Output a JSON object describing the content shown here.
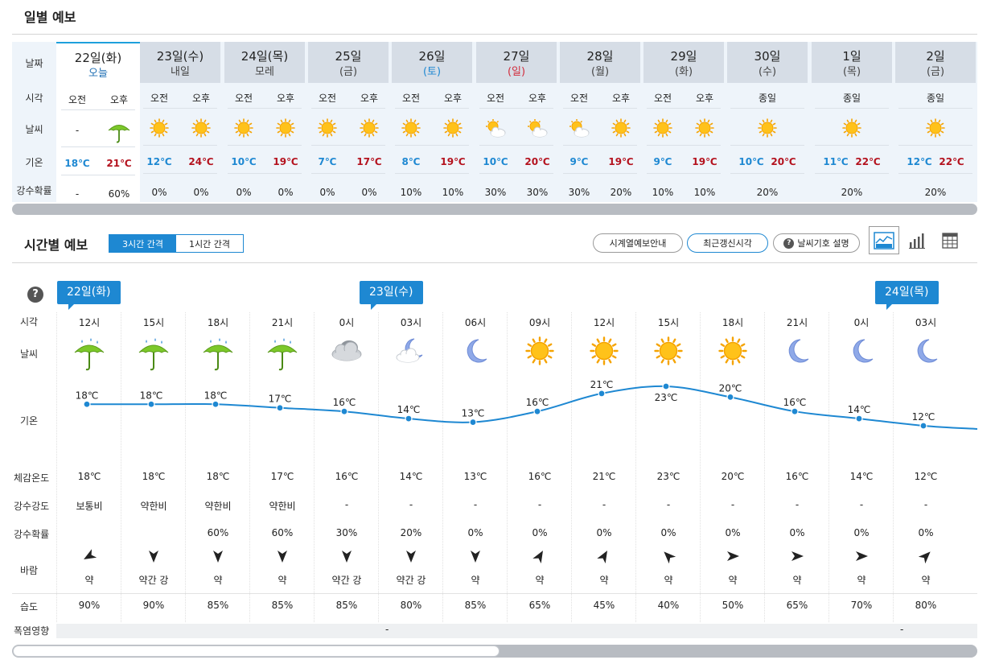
{
  "daily": {
    "title": "일별 예보",
    "row_labels": [
      "날짜",
      "시각",
      "날씨",
      "기온",
      "강수확률"
    ],
    "days": [
      {
        "date": "22일(화)",
        "sub": "오늘",
        "kind": "today",
        "split": true,
        "periods": [
          "오전",
          "오후"
        ],
        "weather": [
          "none",
          "umbrella"
        ],
        "am_text": "-",
        "low": "18℃",
        "high": "21℃",
        "pop": [
          "-",
          "60%"
        ]
      },
      {
        "date": "23일(수)",
        "sub": "내일",
        "kind": "",
        "split": true,
        "periods": [
          "오전",
          "오후"
        ],
        "weather": [
          "sun",
          "sun"
        ],
        "low": "12℃",
        "high": "24℃",
        "pop": [
          "0%",
          "0%"
        ]
      },
      {
        "date": "24일(목)",
        "sub": "모레",
        "kind": "",
        "split": true,
        "periods": [
          "오전",
          "오후"
        ],
        "weather": [
          "sun",
          "sun"
        ],
        "low": "10℃",
        "high": "19℃",
        "pop": [
          "0%",
          "0%"
        ]
      },
      {
        "date": "25일",
        "sub": "(금)",
        "kind": "",
        "split": true,
        "periods": [
          "오전",
          "오후"
        ],
        "weather": [
          "sun",
          "sun"
        ],
        "low": "7℃",
        "high": "17℃",
        "pop": [
          "0%",
          "0%"
        ]
      },
      {
        "date": "26일",
        "sub": "(토)",
        "kind": "sat",
        "split": true,
        "periods": [
          "오전",
          "오후"
        ],
        "weather": [
          "sun",
          "sun"
        ],
        "low": "8℃",
        "high": "19℃",
        "pop": [
          "10%",
          "10%"
        ]
      },
      {
        "date": "27일",
        "sub": "(일)",
        "kind": "sun",
        "split": true,
        "periods": [
          "오전",
          "오후"
        ],
        "weather": [
          "suncloud",
          "suncloud"
        ],
        "low": "10℃",
        "high": "20℃",
        "pop": [
          "30%",
          "30%"
        ]
      },
      {
        "date": "28일",
        "sub": "(월)",
        "kind": "",
        "split": true,
        "periods": [
          "오전",
          "오후"
        ],
        "weather": [
          "suncloud",
          "sun"
        ],
        "low": "9℃",
        "high": "19℃",
        "pop": [
          "30%",
          "20%"
        ]
      },
      {
        "date": "29일",
        "sub": "(화)",
        "kind": "",
        "split": true,
        "periods": [
          "오전",
          "오후"
        ],
        "weather": [
          "sun",
          "sun"
        ],
        "low": "9℃",
        "high": "19℃",
        "pop": [
          "10%",
          "10%"
        ]
      },
      {
        "date": "30일",
        "sub": "(수)",
        "kind": "",
        "split": false,
        "periods": [
          "종일"
        ],
        "weather": [
          "sun"
        ],
        "low": "10℃",
        "high": "20℃",
        "pop": [
          "20%"
        ]
      },
      {
        "date": "1일",
        "sub": "(목)",
        "kind": "",
        "split": false,
        "periods": [
          "종일"
        ],
        "weather": [
          "sun"
        ],
        "low": "11℃",
        "high": "22℃",
        "pop": [
          "20%"
        ]
      },
      {
        "date": "2일",
        "sub": "(금)",
        "kind": "",
        "split": false,
        "periods": [
          "종일"
        ],
        "weather": [
          "sun"
        ],
        "low": "12℃",
        "high": "22℃",
        "pop": [
          "20%"
        ]
      }
    ]
  },
  "hourly": {
    "title": "시간별 예보",
    "interval_3h": "3시간 간격",
    "interval_1h": "1시간 간격",
    "btn_series_guide": "시계열예보안내",
    "btn_latest": "최근갱신시각",
    "btn_symbols": "날씨기호 설명",
    "help": "?",
    "badges": [
      "22일(화)",
      "23일(수)",
      "24일(목)"
    ],
    "row_labels": {
      "time": "시각",
      "weather": "날씨",
      "temp": "기온",
      "feels": "체감온도",
      "precip_intensity": "강수강도",
      "pop": "강수확률",
      "wind": "바람",
      "humidity": "습도",
      "heat": "폭염영향"
    },
    "heat_values": [
      "-",
      "-"
    ],
    "hours": [
      {
        "time": "12시",
        "icon": "umbrella",
        "temp": 18,
        "temp_label": "18℃",
        "feels": "18℃",
        "intensity": "보통비",
        "pop": "",
        "wind_dir": 60,
        "wind": "약",
        "humidity": "90%"
      },
      {
        "time": "15시",
        "icon": "umbrella",
        "temp": 18,
        "temp_label": "18℃",
        "feels": "18℃",
        "intensity": "약한비",
        "pop": "",
        "wind_dir": 0,
        "wind": "약간 강",
        "humidity": "90%"
      },
      {
        "time": "18시",
        "icon": "umbrella",
        "temp": 18,
        "temp_label": "18℃",
        "feels": "18℃",
        "intensity": "약한비",
        "pop": "60%",
        "wind_dir": 0,
        "wind": "약",
        "humidity": "85%"
      },
      {
        "time": "21시",
        "icon": "umbrella",
        "temp": 17,
        "temp_label": "17℃",
        "feels": "17℃",
        "intensity": "약한비",
        "pop": "60%",
        "wind_dir": 0,
        "wind": "약",
        "humidity": "85%"
      },
      {
        "time": "0시",
        "icon": "cloud",
        "temp": 16,
        "temp_label": "16℃",
        "feels": "16℃",
        "intensity": "-",
        "pop": "30%",
        "wind_dir": 0,
        "wind": "약간 강",
        "humidity": "85%"
      },
      {
        "time": "03시",
        "icon": "mooncloud",
        "temp": 14,
        "temp_label": "14℃",
        "feels": "14℃",
        "intensity": "-",
        "pop": "20%",
        "wind_dir": 0,
        "wind": "약간 강",
        "humidity": "80%"
      },
      {
        "time": "06시",
        "icon": "moon",
        "temp": 13,
        "temp_label": "13℃",
        "feels": "13℃",
        "intensity": "-",
        "pop": "0%",
        "wind_dir": 0,
        "wind": "약",
        "humidity": "85%"
      },
      {
        "time": "09시",
        "icon": "sun",
        "temp": 16,
        "temp_label": "16℃",
        "feels": "16℃",
        "intensity": "-",
        "pop": "0%",
        "wind_dir": 210,
        "wind": "약",
        "humidity": "65%"
      },
      {
        "time": "12시",
        "icon": "sun",
        "temp": 21,
        "temp_label": "21℃",
        "feels": "21℃",
        "intensity": "-",
        "pop": "0%",
        "wind_dir": 210,
        "wind": "약",
        "humidity": "45%"
      },
      {
        "time": "15시",
        "icon": "sun",
        "temp": 23,
        "temp_label": "23℃",
        "feels": "23℃",
        "intensity": "-",
        "pop": "0%",
        "wind_dir": 135,
        "wind": "약",
        "humidity": "40%"
      },
      {
        "time": "18시",
        "icon": "sun",
        "temp": 20,
        "temp_label": "20℃",
        "feels": "20℃",
        "intensity": "-",
        "pop": "0%",
        "wind_dir": 270,
        "wind": "약",
        "humidity": "50%"
      },
      {
        "time": "21시",
        "icon": "moon",
        "temp": 16,
        "temp_label": "16℃",
        "feels": "16℃",
        "intensity": "-",
        "pop": "0%",
        "wind_dir": 270,
        "wind": "약",
        "humidity": "65%"
      },
      {
        "time": "0시",
        "icon": "moon",
        "temp": 14,
        "temp_label": "14℃",
        "feels": "14℃",
        "intensity": "-",
        "pop": "0%",
        "wind_dir": 270,
        "wind": "약",
        "humidity": "70%"
      },
      {
        "time": "03시",
        "icon": "moon",
        "temp": 12,
        "temp_label": "12℃",
        "feels": "12℃",
        "intensity": "-",
        "pop": "0%",
        "wind_dir": 225,
        "wind": "약",
        "humidity": "80%"
      }
    ]
  },
  "colors": {
    "accent": "#1e88d2",
    "low_temp": "#1e88d2",
    "high_temp": "#b4121e",
    "sunday": "#d22c3c"
  }
}
